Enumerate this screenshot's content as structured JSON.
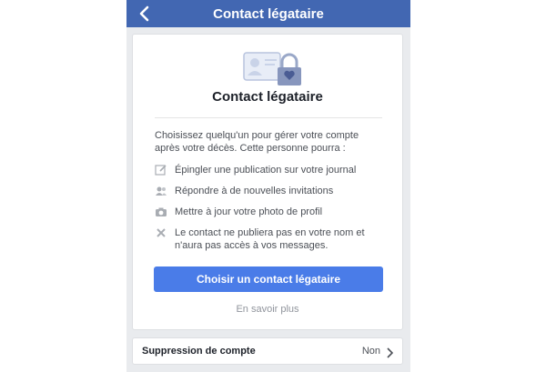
{
  "navbar": {
    "title": "Contact légataire"
  },
  "card": {
    "title": "Contact légataire",
    "intro": "Choisissez quelqu'un pour gérer votre compte après votre décès. Cette personne pourra :",
    "items": [
      {
        "icon": "pencil-icon",
        "label": "Épingler une publication sur votre journal"
      },
      {
        "icon": "friends-icon",
        "label": "Répondre à de nouvelles invitations"
      },
      {
        "icon": "camera-icon",
        "label": "Mettre à jour votre photo de profil"
      },
      {
        "icon": "x-icon",
        "label": "Le contact ne publiera pas en votre nom et n'aura pas accès à vos messages."
      }
    ],
    "cta_label": "Choisir un contact légataire",
    "learn_more": "En savoir plus"
  },
  "setting": {
    "label": "Suppression de compte",
    "value": "Non"
  },
  "colors": {
    "navbar": "#4267b2",
    "button": "#4a7ce8",
    "background": "#e9ebee"
  }
}
